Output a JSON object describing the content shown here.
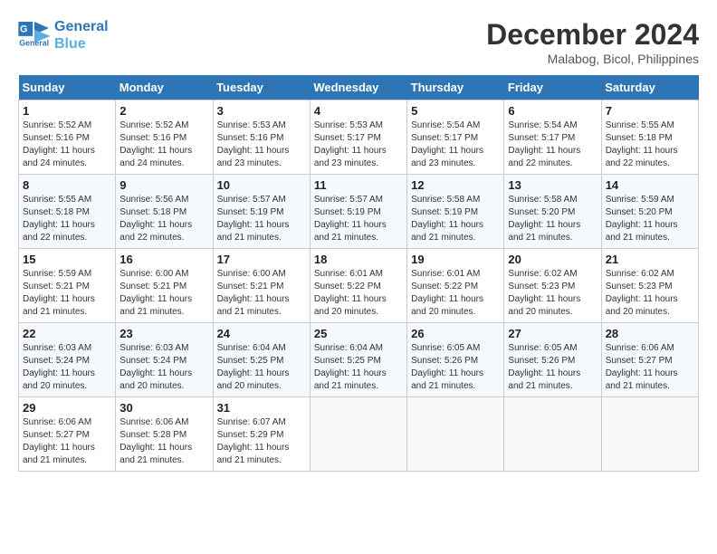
{
  "logo": {
    "line1": "General",
    "line2": "Blue"
  },
  "title": "December 2024",
  "location": "Malabog, Bicol, Philippines",
  "headers": [
    "Sunday",
    "Monday",
    "Tuesday",
    "Wednesday",
    "Thursday",
    "Friday",
    "Saturday"
  ],
  "weeks": [
    [
      {
        "day": "1",
        "info": "Sunrise: 5:52 AM\nSunset: 5:16 PM\nDaylight: 11 hours\nand 24 minutes."
      },
      {
        "day": "2",
        "info": "Sunrise: 5:52 AM\nSunset: 5:16 PM\nDaylight: 11 hours\nand 24 minutes."
      },
      {
        "day": "3",
        "info": "Sunrise: 5:53 AM\nSunset: 5:16 PM\nDaylight: 11 hours\nand 23 minutes."
      },
      {
        "day": "4",
        "info": "Sunrise: 5:53 AM\nSunset: 5:17 PM\nDaylight: 11 hours\nand 23 minutes."
      },
      {
        "day": "5",
        "info": "Sunrise: 5:54 AM\nSunset: 5:17 PM\nDaylight: 11 hours\nand 23 minutes."
      },
      {
        "day": "6",
        "info": "Sunrise: 5:54 AM\nSunset: 5:17 PM\nDaylight: 11 hours\nand 22 minutes."
      },
      {
        "day": "7",
        "info": "Sunrise: 5:55 AM\nSunset: 5:18 PM\nDaylight: 11 hours\nand 22 minutes."
      }
    ],
    [
      {
        "day": "8",
        "info": "Sunrise: 5:55 AM\nSunset: 5:18 PM\nDaylight: 11 hours\nand 22 minutes."
      },
      {
        "day": "9",
        "info": "Sunrise: 5:56 AM\nSunset: 5:18 PM\nDaylight: 11 hours\nand 22 minutes."
      },
      {
        "day": "10",
        "info": "Sunrise: 5:57 AM\nSunset: 5:19 PM\nDaylight: 11 hours\nand 21 minutes."
      },
      {
        "day": "11",
        "info": "Sunrise: 5:57 AM\nSunset: 5:19 PM\nDaylight: 11 hours\nand 21 minutes."
      },
      {
        "day": "12",
        "info": "Sunrise: 5:58 AM\nSunset: 5:19 PM\nDaylight: 11 hours\nand 21 minutes."
      },
      {
        "day": "13",
        "info": "Sunrise: 5:58 AM\nSunset: 5:20 PM\nDaylight: 11 hours\nand 21 minutes."
      },
      {
        "day": "14",
        "info": "Sunrise: 5:59 AM\nSunset: 5:20 PM\nDaylight: 11 hours\nand 21 minutes."
      }
    ],
    [
      {
        "day": "15",
        "info": "Sunrise: 5:59 AM\nSunset: 5:21 PM\nDaylight: 11 hours\nand 21 minutes."
      },
      {
        "day": "16",
        "info": "Sunrise: 6:00 AM\nSunset: 5:21 PM\nDaylight: 11 hours\nand 21 minutes."
      },
      {
        "day": "17",
        "info": "Sunrise: 6:00 AM\nSunset: 5:21 PM\nDaylight: 11 hours\nand 21 minutes."
      },
      {
        "day": "18",
        "info": "Sunrise: 6:01 AM\nSunset: 5:22 PM\nDaylight: 11 hours\nand 20 minutes."
      },
      {
        "day": "19",
        "info": "Sunrise: 6:01 AM\nSunset: 5:22 PM\nDaylight: 11 hours\nand 20 minutes."
      },
      {
        "day": "20",
        "info": "Sunrise: 6:02 AM\nSunset: 5:23 PM\nDaylight: 11 hours\nand 20 minutes."
      },
      {
        "day": "21",
        "info": "Sunrise: 6:02 AM\nSunset: 5:23 PM\nDaylight: 11 hours\nand 20 minutes."
      }
    ],
    [
      {
        "day": "22",
        "info": "Sunrise: 6:03 AM\nSunset: 5:24 PM\nDaylight: 11 hours\nand 20 minutes."
      },
      {
        "day": "23",
        "info": "Sunrise: 6:03 AM\nSunset: 5:24 PM\nDaylight: 11 hours\nand 20 minutes."
      },
      {
        "day": "24",
        "info": "Sunrise: 6:04 AM\nSunset: 5:25 PM\nDaylight: 11 hours\nand 20 minutes."
      },
      {
        "day": "25",
        "info": "Sunrise: 6:04 AM\nSunset: 5:25 PM\nDaylight: 11 hours\nand 21 minutes."
      },
      {
        "day": "26",
        "info": "Sunrise: 6:05 AM\nSunset: 5:26 PM\nDaylight: 11 hours\nand 21 minutes."
      },
      {
        "day": "27",
        "info": "Sunrise: 6:05 AM\nSunset: 5:26 PM\nDaylight: 11 hours\nand 21 minutes."
      },
      {
        "day": "28",
        "info": "Sunrise: 6:06 AM\nSunset: 5:27 PM\nDaylight: 11 hours\nand 21 minutes."
      }
    ],
    [
      {
        "day": "29",
        "info": "Sunrise: 6:06 AM\nSunset: 5:27 PM\nDaylight: 11 hours\nand 21 minutes."
      },
      {
        "day": "30",
        "info": "Sunrise: 6:06 AM\nSunset: 5:28 PM\nDaylight: 11 hours\nand 21 minutes."
      },
      {
        "day": "31",
        "info": "Sunrise: 6:07 AM\nSunset: 5:29 PM\nDaylight: 11 hours\nand 21 minutes."
      },
      {
        "day": "",
        "info": ""
      },
      {
        "day": "",
        "info": ""
      },
      {
        "day": "",
        "info": ""
      },
      {
        "day": "",
        "info": ""
      }
    ]
  ]
}
